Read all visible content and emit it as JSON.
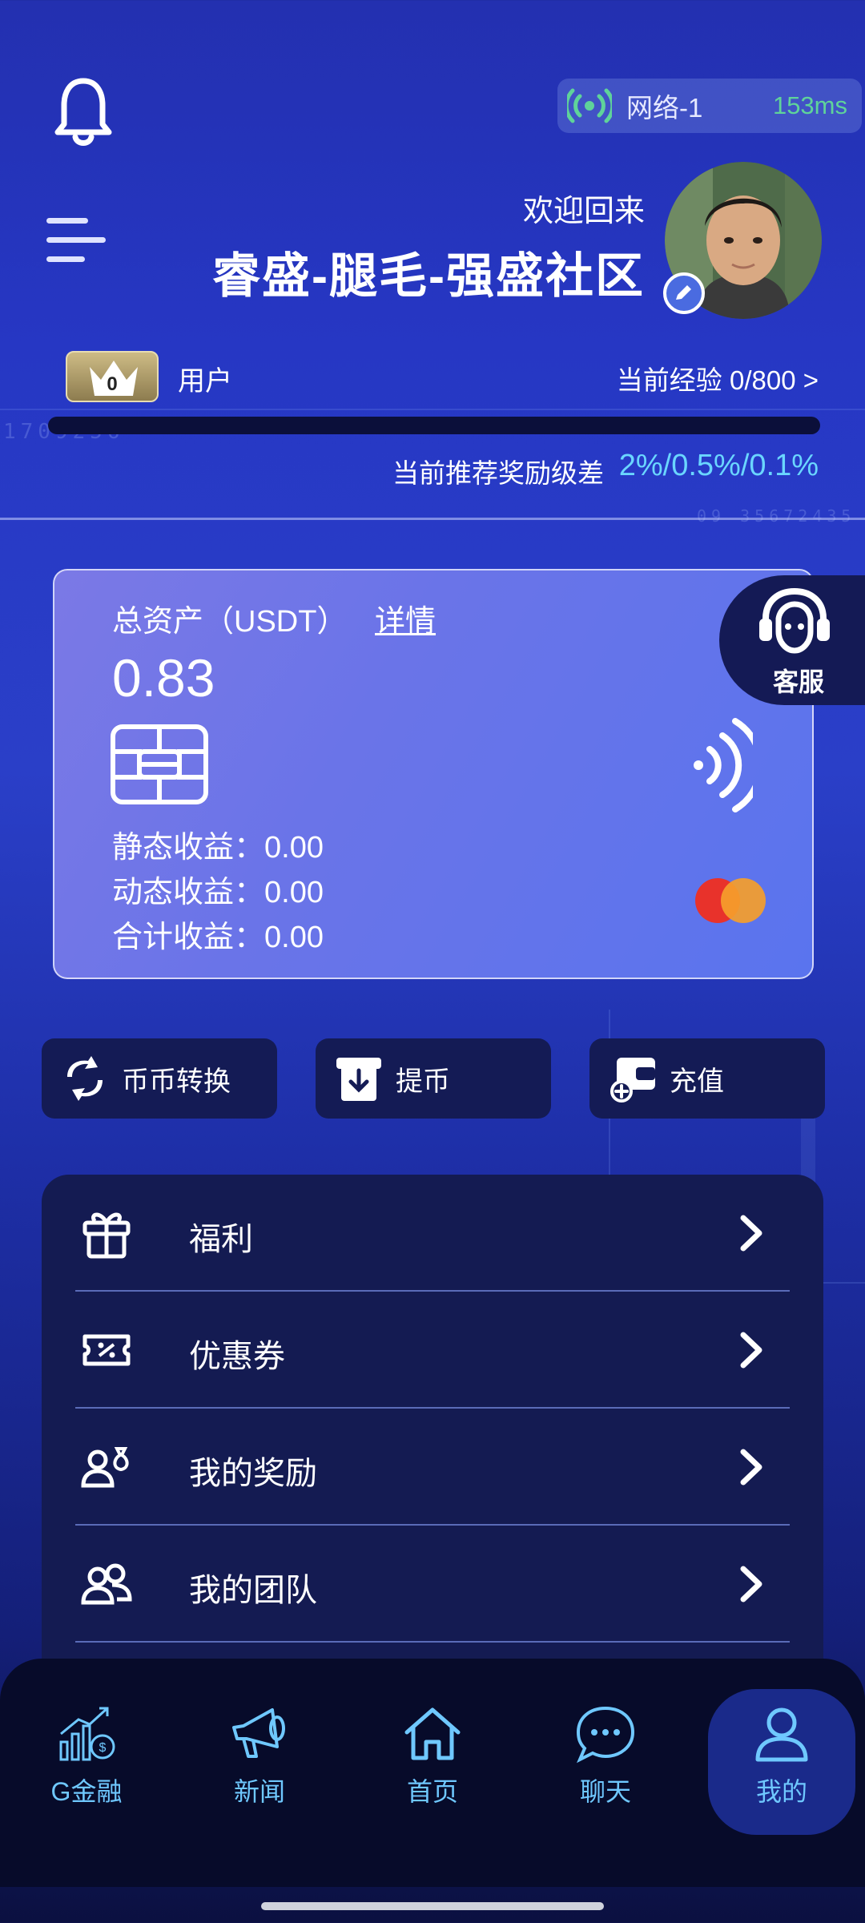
{
  "header": {
    "network_name": "网络-1",
    "latency": "153ms",
    "welcome": "欢迎回来",
    "community": "睿盛-腿毛-强盛社区"
  },
  "level": {
    "badge_level": "0",
    "role": "用户",
    "experience": "当前经验 0/800 >",
    "experience_progress": 0,
    "diff_label": "当前推荐奖励级差",
    "diff_value": "2%/0.5%/0.1%"
  },
  "asset_card": {
    "title": "总资产（USDT）",
    "detail_link": "详情",
    "total": "0.83",
    "static_income": "静态收益：0.00",
    "dynamic_income": "动态收益：0.00",
    "total_income": "合计收益：0.00"
  },
  "customer_service": "客服",
  "actions": [
    {
      "label": "币币转换",
      "icon": "exchange-icon"
    },
    {
      "label": "提币",
      "icon": "withdraw-icon"
    },
    {
      "label": "充值",
      "icon": "wallet-icon"
    }
  ],
  "menu": [
    {
      "label": "福利",
      "icon": "gift-icon"
    },
    {
      "label": "优惠券",
      "icon": "coupon-icon"
    },
    {
      "label": "我的奖励",
      "icon": "reward-icon"
    },
    {
      "label": "我的团队",
      "icon": "team-icon"
    }
  ],
  "nav": [
    {
      "label": "G金融",
      "icon": "finance-chart-icon"
    },
    {
      "label": "新闻",
      "icon": "megaphone-icon"
    },
    {
      "label": "首页",
      "icon": "home-icon"
    },
    {
      "label": "聊天",
      "icon": "chat-icon"
    },
    {
      "label": "我的",
      "icon": "user-icon",
      "active": true
    }
  ],
  "colors": {
    "accent": "#6fc8ff",
    "latency_green": "#5fd39a",
    "card_bg": "#6a74e8",
    "panel_bg": "#141b52"
  }
}
